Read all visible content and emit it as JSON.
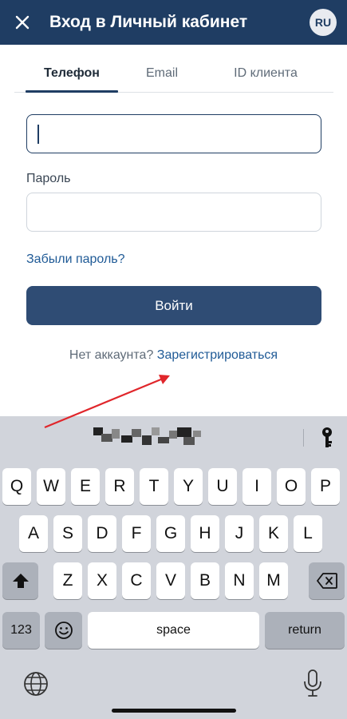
{
  "header": {
    "title": "Вход в Личный кабинет",
    "language": "RU",
    "close_icon": "close-icon"
  },
  "tabs": [
    {
      "label": "Телефон",
      "active": true
    },
    {
      "label": "Email",
      "active": false
    },
    {
      "label": "ID клиента",
      "active": false
    }
  ],
  "form": {
    "phone_value": "",
    "password_label": "Пароль",
    "password_value": "",
    "forgot_password": "Забыли пароль?",
    "login_button": "Войти",
    "no_account": "Нет аккаунта?",
    "register_link": "Зарегистрироваться"
  },
  "annotation": {
    "arrow_color": "#e0262b"
  },
  "keyboard": {
    "row1": [
      "Q",
      "W",
      "E",
      "R",
      "T",
      "Y",
      "U",
      "I",
      "O",
      "P"
    ],
    "row2": [
      "A",
      "S",
      "D",
      "F",
      "G",
      "H",
      "J",
      "K",
      "L"
    ],
    "row3": [
      "Z",
      "X",
      "C",
      "V",
      "B",
      "N",
      "M"
    ],
    "numbers_key": "123",
    "space_key": "space",
    "return_key": "return",
    "icons": [
      "key-icon",
      "shift-icon",
      "backspace-icon",
      "emoji-icon",
      "globe-icon",
      "microphone-icon"
    ]
  },
  "colors": {
    "header_bg": "#1f3d63",
    "button_bg": "#2f4c74",
    "link": "#1f5a96",
    "keyboard_bg": "#d1d4db"
  }
}
